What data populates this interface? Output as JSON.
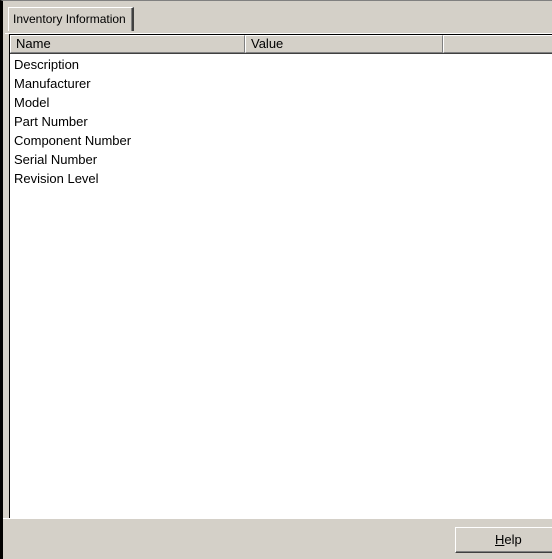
{
  "tabs": [
    {
      "label": "Inventory Information",
      "selected": true
    }
  ],
  "list": {
    "columns": [
      "Name",
      "Value",
      ""
    ],
    "rows": [
      {
        "name": "Description",
        "value": ""
      },
      {
        "name": "Manufacturer",
        "value": ""
      },
      {
        "name": "Model",
        "value": ""
      },
      {
        "name": "Part Number",
        "value": ""
      },
      {
        "name": "Component Number",
        "value": ""
      },
      {
        "name": "Serial Number",
        "value": ""
      },
      {
        "name": "Revision Level",
        "value": ""
      }
    ]
  },
  "buttons": {
    "help_accel": "H",
    "help_rest": "elp"
  },
  "colors": {
    "face": "#d4d0c8",
    "list_background": "#ffffff"
  }
}
